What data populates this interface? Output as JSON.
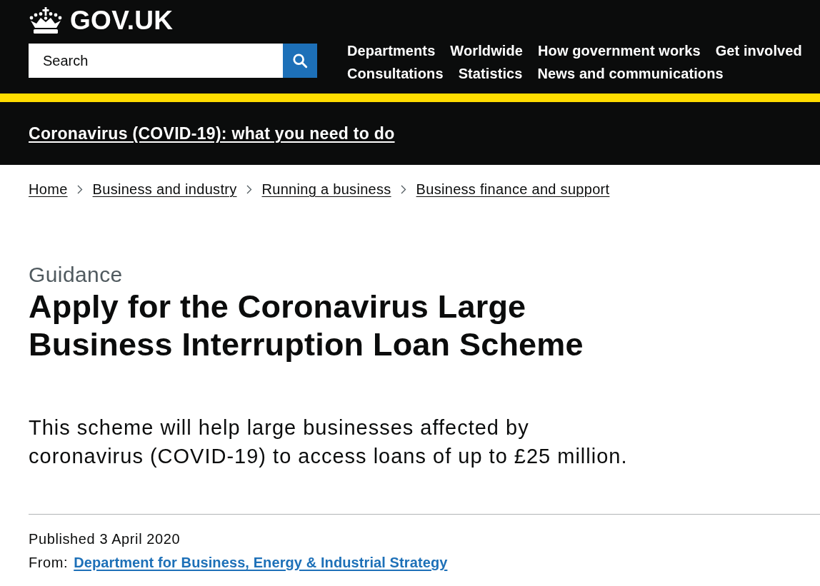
{
  "header": {
    "logo_text": "GOV.UK",
    "search": {
      "placeholder": "Search"
    },
    "navigation": [
      "Departments",
      "Worldwide",
      "How government works",
      "Get involved",
      "Consultations",
      "Statistics",
      "News and communications"
    ]
  },
  "banner": {
    "link": "Coronavirus (COVID-19): what you need to do"
  },
  "breadcrumbs": [
    "Home",
    "Business and industry",
    "Running a business",
    "Business finance and support"
  ],
  "document_type": "Guidance",
  "title": "Apply for the Coronavirus Large Business Interruption Loan Scheme",
  "summary": "This scheme will help large businesses affected by coronavirus (COVID-19) to access loans of up to £25 million.",
  "metadata": {
    "published": "Published 3 April 2020",
    "from_label": "From:",
    "from_link": "Department for Business, Energy & Industrial Strategy"
  }
}
